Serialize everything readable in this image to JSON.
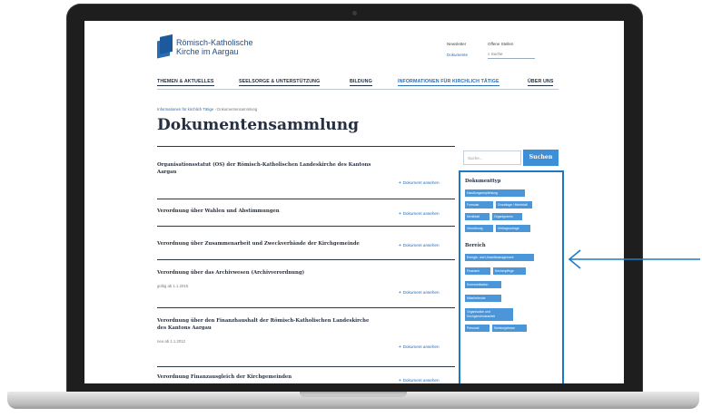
{
  "site": {
    "logo_line1": "Römisch-Katholische",
    "logo_line2": "Kirche im Aargau",
    "header_links": [
      "Newsletter",
      "Offene Stellen",
      "Dokumente"
    ],
    "search_placeholder": "Suche"
  },
  "nav": {
    "items": [
      "THEMEN & AKTUELLES",
      "SEELSORGE & UNTERSTÜTZUNG",
      "BILDUNG",
      "INFORMATIONEN FÜR KIRCHLICH TÄTIGE",
      "ÜBER UNS"
    ],
    "active_index": 3
  },
  "breadcrumb": {
    "parent": "Informationen für kirchlich Tätige",
    "separator": "›",
    "current": "Dokumentensammlung"
  },
  "page": {
    "title": "Dokumentensammlung"
  },
  "documents": {
    "link_label": "Dokument ansehen",
    "items": [
      {
        "title": "Organisationsstatut (OS) der Römisch-Katholischen Landeskirche des Kantons Aargau",
        "meta": ""
      },
      {
        "title": "Verordnung über Wahlen und Abstimmungen",
        "meta": ""
      },
      {
        "title": "Verordnung über Zusammenarbeit und Zweckverbände der Kirchgemeinde",
        "meta": ""
      },
      {
        "title": "Verordnung über das Archivwesen (Archivverordnung)",
        "meta": "gültig ab 1.1.2015"
      },
      {
        "title": "Verordnung über den Finanzhaushalt der Römisch-Katholischen Landeskirche des Kantons Aargau",
        "meta": "neu ab 1.1.2012"
      },
      {
        "title": "Verordnung Finanzausgleich der Kirchgemeinden",
        "meta": ""
      }
    ]
  },
  "sidebar": {
    "search_placeholder": "Suche...",
    "search_button": "Suchen",
    "facet1_heading": "Dokumenttyp",
    "facet1_chips": [
      "Handlungsempfehlung",
      "Formular",
      "Grundlage / Merkblatt",
      "Merkblatt",
      "Organigramm",
      "Verordnung",
      "Vertragsvorlage"
    ],
    "facet2_heading": "Bereich",
    "facet2_chips": [
      "Energie- und Umweltmanagement",
      "Finanzen",
      "Kirchenpflege",
      "Kommunikation",
      "Mitarbeitende",
      "Organisation und Kirchgemeindearbeit",
      "Personal",
      "Seelsorgeteam"
    ]
  },
  "colors": {
    "accent": "#2a6db4",
    "chip": "#4b96d9",
    "highlight": "#1e78c8",
    "frame": "#1e1e1e"
  },
  "annotation": {
    "icon": "arrow-left-icon"
  }
}
